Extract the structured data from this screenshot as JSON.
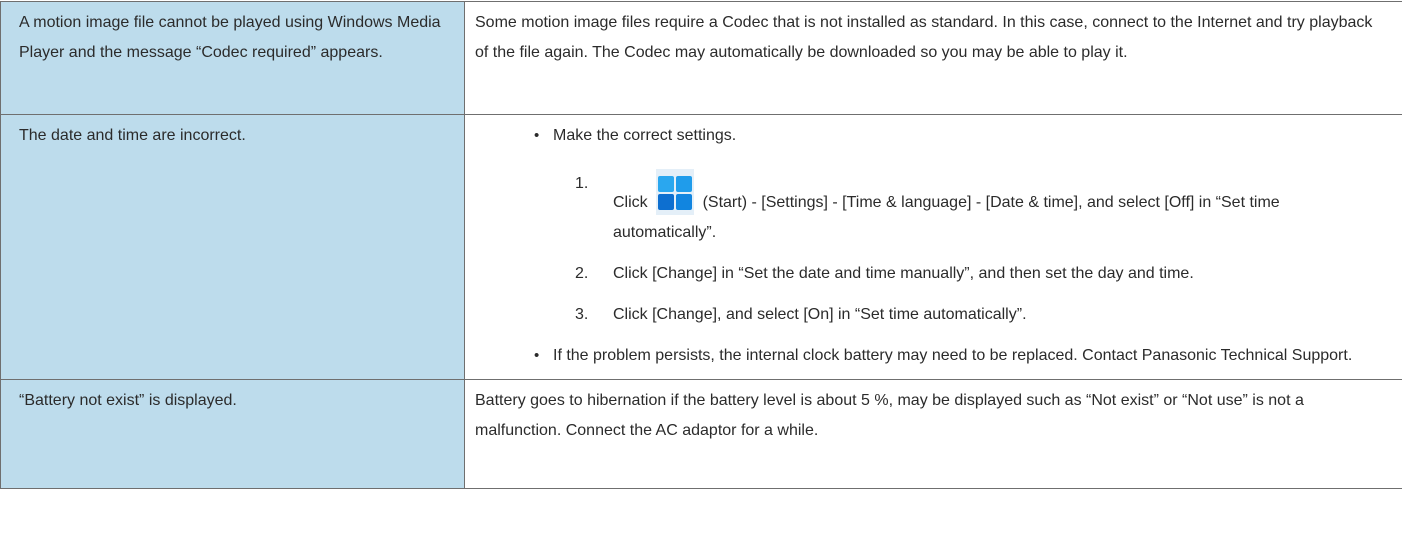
{
  "rows": [
    {
      "problem": "A motion image file cannot be played using Windows Media Player and the message “Codec required” appears.",
      "solution": "Some motion image files require a Codec that is not installed as standard. In this case, connect to the Internet and try playback of the file again. The Codec may automatically be downloaded so you may be able to play it."
    },
    {
      "problem": "The date and time are incorrect.",
      "bullet1": "Make the correct settings.",
      "steps": [
        {
          "num": "1.",
          "pre": "Click",
          "icon": "windows-start-icon",
          "post": "(Start) - [Settings] - [Time & language] - [Date & time], and select [Off] in “Set time automatically”."
        },
        {
          "num": "2.",
          "text": "Click [Change] in “Set the date and time manually”, and then set the day and time."
        },
        {
          "num": "3.",
          "text": "Click [Change], and select [On] in “Set time automatically”."
        }
      ],
      "bullet2": "If the problem persists, the internal clock battery may need to be replaced. Contact Panasonic Technical Support."
    },
    {
      "problem": "“Battery not exist” is displayed.",
      "solution": "Battery goes to hibernation if the battery level is about 5 %, may be displayed such as “Not exist” or “Not use” is not a malfunction. Connect the AC adaptor for a while."
    }
  ],
  "colors": {
    "problem_bg": "#bddcec",
    "border": "#6f6f6f",
    "text": "#2b2b2b"
  }
}
